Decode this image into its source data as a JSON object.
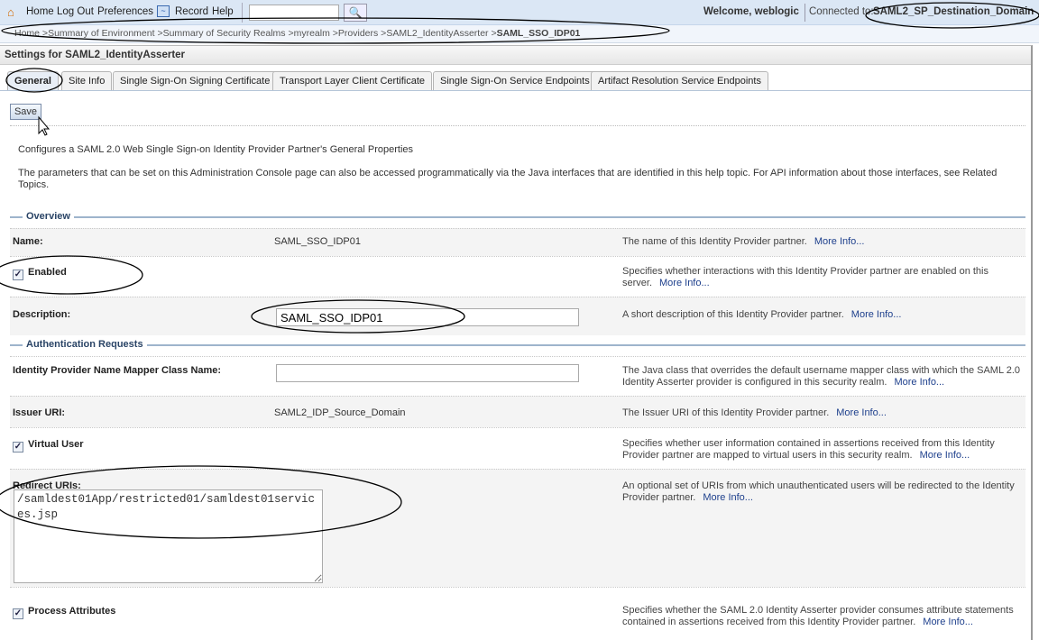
{
  "topbar": {
    "home": "Home",
    "logout": "Log Out",
    "preferences": "Preferences",
    "record": "Record",
    "help": "Help",
    "search_value": "",
    "welcome": "Welcome, weblogic",
    "connected_label": "Connected to:",
    "domain": "SAML2_SP_Destination_Domain"
  },
  "breadcrumb": {
    "items": [
      "Home >",
      "Summary of Environment >",
      "Summary of Security Realms >",
      "myrealm >",
      "Providers >",
      "SAML2_IdentityAsserter >"
    ],
    "current": "SAML_SSO_IDP01"
  },
  "panel_title": "Settings for SAML2_IdentityAsserter",
  "tabs": [
    "General",
    "Site Info",
    "Single Sign-On Signing Certificate",
    "Transport Layer Client Certificate",
    "Single Sign-On Service Endpoints",
    "Artifact Resolution Service Endpoints"
  ],
  "save_label": "Save",
  "intro1": "Configures a SAML 2.0 Web Single Sign-on Identity Provider Partner's General Properties",
  "intro2": "The parameters that can be set on this Administration Console page can also be accessed programmatically via the Java interfaces that are identified in this help topic. For API information about those interfaces, see Related Topics.",
  "more_info": "More Info...",
  "overview": {
    "heading": "Overview",
    "name_label": "Name:",
    "name_value": "SAML_SSO_IDP01",
    "name_help": "The name of this Identity Provider partner.",
    "enabled_label": "Enabled",
    "enabled_checked": true,
    "enabled_help": "Specifies whether interactions with this Identity Provider partner are enabled on this server.",
    "description_label": "Description:",
    "description_value": "SAML_SSO_IDP01",
    "description_help": "A short description of this Identity Provider partner."
  },
  "auth": {
    "heading": "Authentication Requests",
    "mapper_label": "Identity Provider Name Mapper Class Name:",
    "mapper_value": "",
    "mapper_help": "The Java class that overrides the default username mapper class with which the SAML 2.0 Identity Asserter provider is configured in this security realm.",
    "issuer_label": "Issuer URI:",
    "issuer_value": "SAML2_IDP_Source_Domain",
    "issuer_help": "The Issuer URI of this Identity Provider partner.",
    "virtual_label": "Virtual User",
    "virtual_checked": true,
    "virtual_help": "Specifies whether user information contained in assertions received from this Identity Provider partner are mapped to virtual users in this security realm.",
    "redirect_label": "Redirect URIs:",
    "redirect_value": "/samldest01App/restricted01/samldest01services.jsp",
    "redirect_help": "An optional set of URIs from which unauthenticated users will be redirected to the Identity Provider partner.",
    "process_label": "Process Attributes",
    "process_checked": true,
    "process_help": "Specifies whether the SAML 2.0 Identity Asserter provider consumes attribute statements contained in assertions received from this Identity Provider partner."
  }
}
